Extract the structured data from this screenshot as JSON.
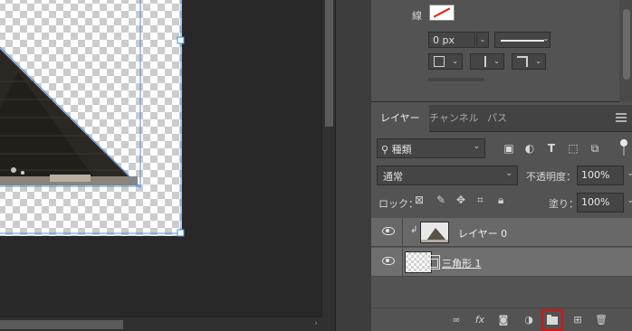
{
  "properties": {
    "stroke_label": "線",
    "stroke_width": "0 px",
    "stroke_color": "#ff0000"
  },
  "layers_panel": {
    "tabs": [
      {
        "label": "レイヤー",
        "active": true
      },
      {
        "label": "チャンネル",
        "active": false
      },
      {
        "label": "パス",
        "active": false
      }
    ],
    "filter_label": "種類",
    "blend_mode": "通常",
    "opacity_label": "不透明度：",
    "opacity_value": "100%",
    "lock_label": "ロック：",
    "fill_label": "塗り：",
    "fill_value": "100%",
    "layers": [
      {
        "name": "レイヤー 0",
        "visible": true,
        "clipped": true,
        "thumbnail": "pyramid-photo"
      },
      {
        "name": "三角形 1",
        "visible": true,
        "clipped": false,
        "thumbnail": "transparent-shape"
      }
    ],
    "bottom_icons": [
      "link-icon",
      "fx-icon",
      "mask-icon",
      "adjustment-icon",
      "new-group-icon",
      "new-layer-icon",
      "trash-icon"
    ],
    "highlighted_icon": "new-group-icon",
    "highlight_color": "#e01010"
  },
  "canvas": {
    "selection_color": "#4a90e2"
  }
}
